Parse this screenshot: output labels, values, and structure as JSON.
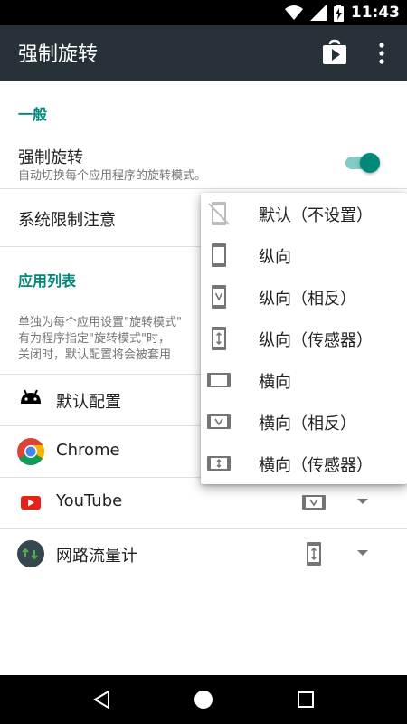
{
  "status_bar": {
    "time": "11:43"
  },
  "app_bar": {
    "title": "强制旋转"
  },
  "general": {
    "header": "一般",
    "force_rotation": {
      "title": "强制旋转",
      "summary": "自动切换每个应用程序的旋转模式。",
      "enabled": true
    },
    "system_limit": {
      "title": "系统限制注意"
    }
  },
  "app_list": {
    "header": "应用列表",
    "description": [
      "单独为每个应用设置\"旋转模式\"",
      "有为程序指定\"旋转模式\"时，",
      "关闭时，默认配置将会被套用"
    ],
    "apps": [
      {
        "label": "默认配置",
        "icon": "android-icon",
        "mode_icon": ""
      },
      {
        "label": "Chrome",
        "icon": "chrome-icon",
        "mode_icon": ""
      },
      {
        "label": "YouTube",
        "icon": "youtube-icon",
        "mode_icon": "landscape-reverse-icon"
      },
      {
        "label": "网路流量计",
        "icon": "network-meter-icon",
        "mode_icon": "portrait-sensor-icon"
      }
    ]
  },
  "rotation_menu": {
    "items": [
      {
        "label": "默认（不设置）",
        "icon": "no-rotation-icon"
      },
      {
        "label": "纵向",
        "icon": "portrait-icon"
      },
      {
        "label": "纵向（相反）",
        "icon": "portrait-reverse-icon"
      },
      {
        "label": "纵向（传感器）",
        "icon": "portrait-sensor-icon"
      },
      {
        "label": "横向",
        "icon": "landscape-icon"
      },
      {
        "label": "横向（相反）",
        "icon": "landscape-reverse-icon"
      },
      {
        "label": "横向（传感器）",
        "icon": "landscape-sensor-icon"
      }
    ]
  },
  "colors": {
    "accent": "#00897b",
    "app_bar": "#263238",
    "toggle_track": "#80cbc4"
  }
}
